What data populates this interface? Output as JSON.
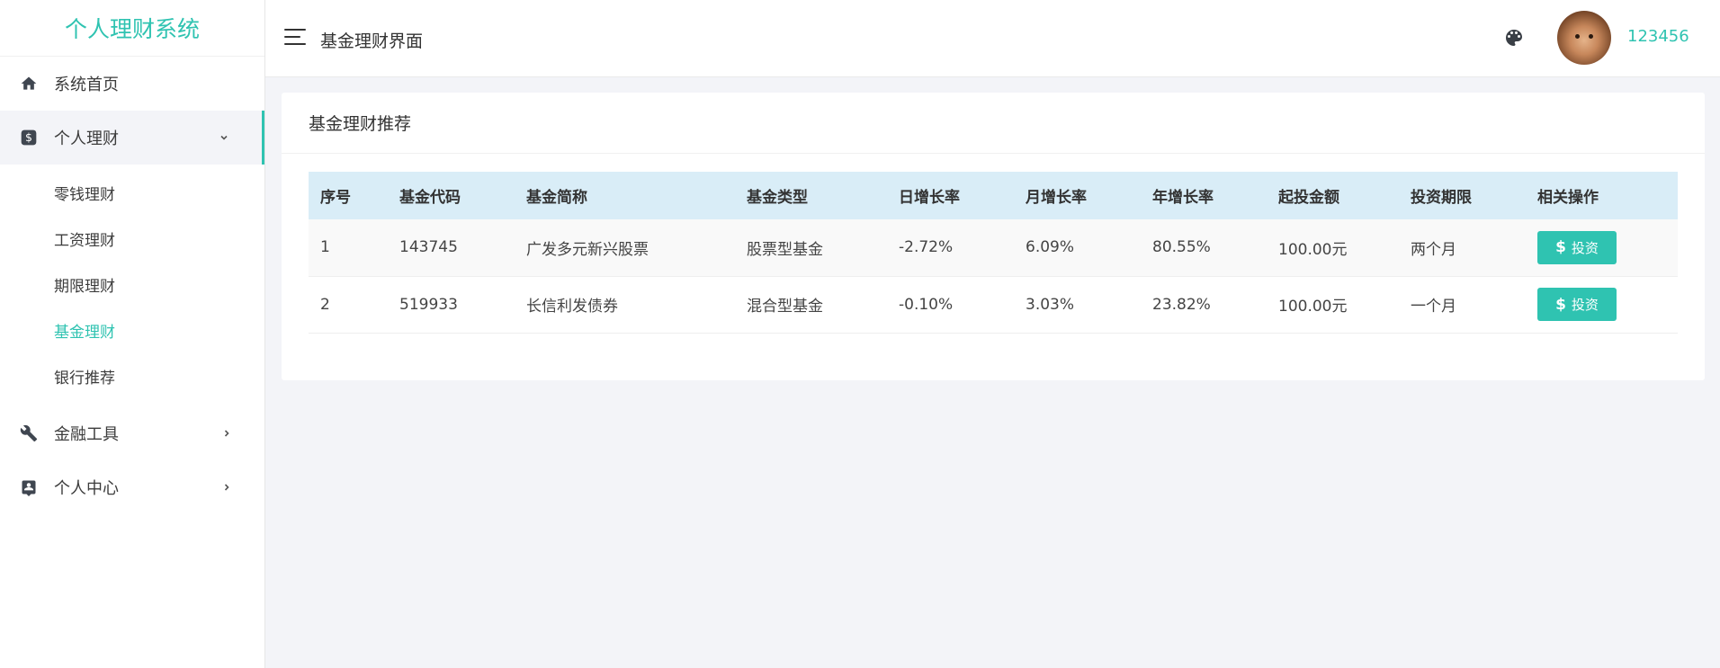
{
  "app": {
    "brand": "个人理财系统"
  },
  "sidebar": {
    "items": [
      {
        "label": "系统首页",
        "icon": "home-icon"
      },
      {
        "label": "个人理财",
        "icon": "dollar-icon",
        "expanded": true,
        "children": [
          "零钱理财",
          "工资理财",
          "期限理财",
          "基金理财",
          "银行推荐"
        ],
        "active_child": "基金理财"
      },
      {
        "label": "金融工具",
        "icon": "wrench-icon"
      },
      {
        "label": "个人中心",
        "icon": "contact-card-icon"
      }
    ]
  },
  "header": {
    "title": "基金理财界面",
    "username": "123456"
  },
  "card": {
    "title": "基金理财推荐",
    "columns": [
      "序号",
      "基金代码",
      "基金简称",
      "基金类型",
      "日增长率",
      "月增长率",
      "年增长率",
      "起投金额",
      "投资期限",
      "相关操作"
    ],
    "rows": [
      {
        "no": "1",
        "code": "143745",
        "name": "广发多元新兴股票",
        "type": "股票型基金",
        "daily": "-2.72%",
        "monthly": "6.09%",
        "yearly": "80.55%",
        "min": "100.00元",
        "term": "两个月",
        "action": "投资"
      },
      {
        "no": "2",
        "code": "519933",
        "name": "长信利发债券",
        "type": "混合型基金",
        "daily": "-0.10%",
        "monthly": "3.03%",
        "yearly": "23.82%",
        "min": "100.00元",
        "term": "一个月",
        "action": "投资"
      }
    ]
  },
  "colors": {
    "accent": "#2fc3b1",
    "table_header": "#d9edf7",
    "background": "#f3f4f8"
  }
}
